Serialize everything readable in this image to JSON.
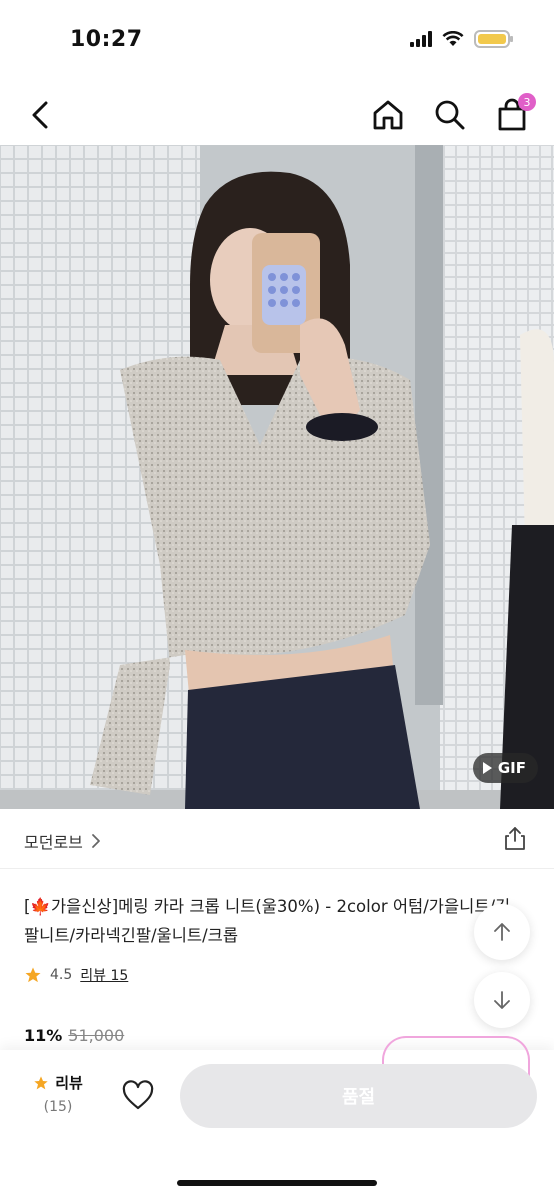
{
  "status_bar": {
    "time": "10:27"
  },
  "nav": {
    "cart_count": "3"
  },
  "product_image": {
    "gif_label": "GIF"
  },
  "brand": {
    "name": "모던로브"
  },
  "product": {
    "title": "[🍁가을신상]메링 카라 크롭 니트(울30%) - 2color 어텀/가을니트/긴팔니트/카라넥긴팔/울니트/크롭",
    "rating": "4.5",
    "review_link": "리뷰 15",
    "discount": "11%",
    "original_price": "51,000"
  },
  "bottom_bar": {
    "review_label": "리뷰",
    "review_count": "(15)",
    "soldout_label": "품절"
  },
  "colors": {
    "badge": "#e05fc8",
    "star": "#f5a623",
    "soldout_bg": "#e7e7e9",
    "battery": "#f2c94c"
  }
}
